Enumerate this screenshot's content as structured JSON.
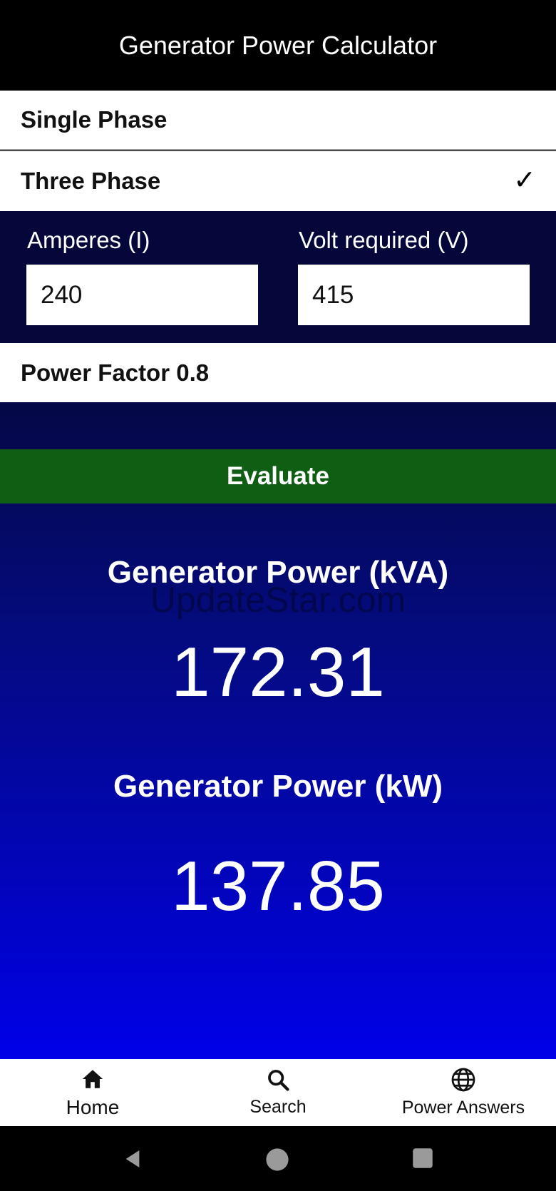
{
  "app": {
    "title": "Generator Power Calculator"
  },
  "phase_options": [
    {
      "label": "Single Phase",
      "selected": false
    },
    {
      "label": "Three Phase",
      "selected": true,
      "check": "✓"
    }
  ],
  "inputs": {
    "amperes": {
      "label": "Amperes (I)",
      "value": "240"
    },
    "volts": {
      "label": "Volt required (V)",
      "value": "415"
    }
  },
  "power_factor": {
    "label": "Power Factor 0.8"
  },
  "evaluate_button": {
    "label": "Evaluate"
  },
  "results": {
    "kva": {
      "title": "Generator Power (kVA)",
      "value": "172.31"
    },
    "kw": {
      "title": "Generator Power (kW)",
      "value": "137.85"
    }
  },
  "watermark": "UpdateStar.com",
  "bottom_nav": [
    {
      "label": "Home",
      "icon": "home-icon"
    },
    {
      "label": "Search",
      "icon": "search-icon"
    },
    {
      "label": "Power Answers",
      "icon": "globe-icon"
    }
  ],
  "system_nav": [
    {
      "icon": "back-icon"
    },
    {
      "icon": "home-circle-icon"
    },
    {
      "icon": "recents-icon"
    }
  ],
  "colors": {
    "accent_green": "#0f5e14",
    "header_bg": "#000000",
    "inputs_bg": "#05073a",
    "gradient_top": "#050845",
    "gradient_bottom": "#0000e8"
  }
}
